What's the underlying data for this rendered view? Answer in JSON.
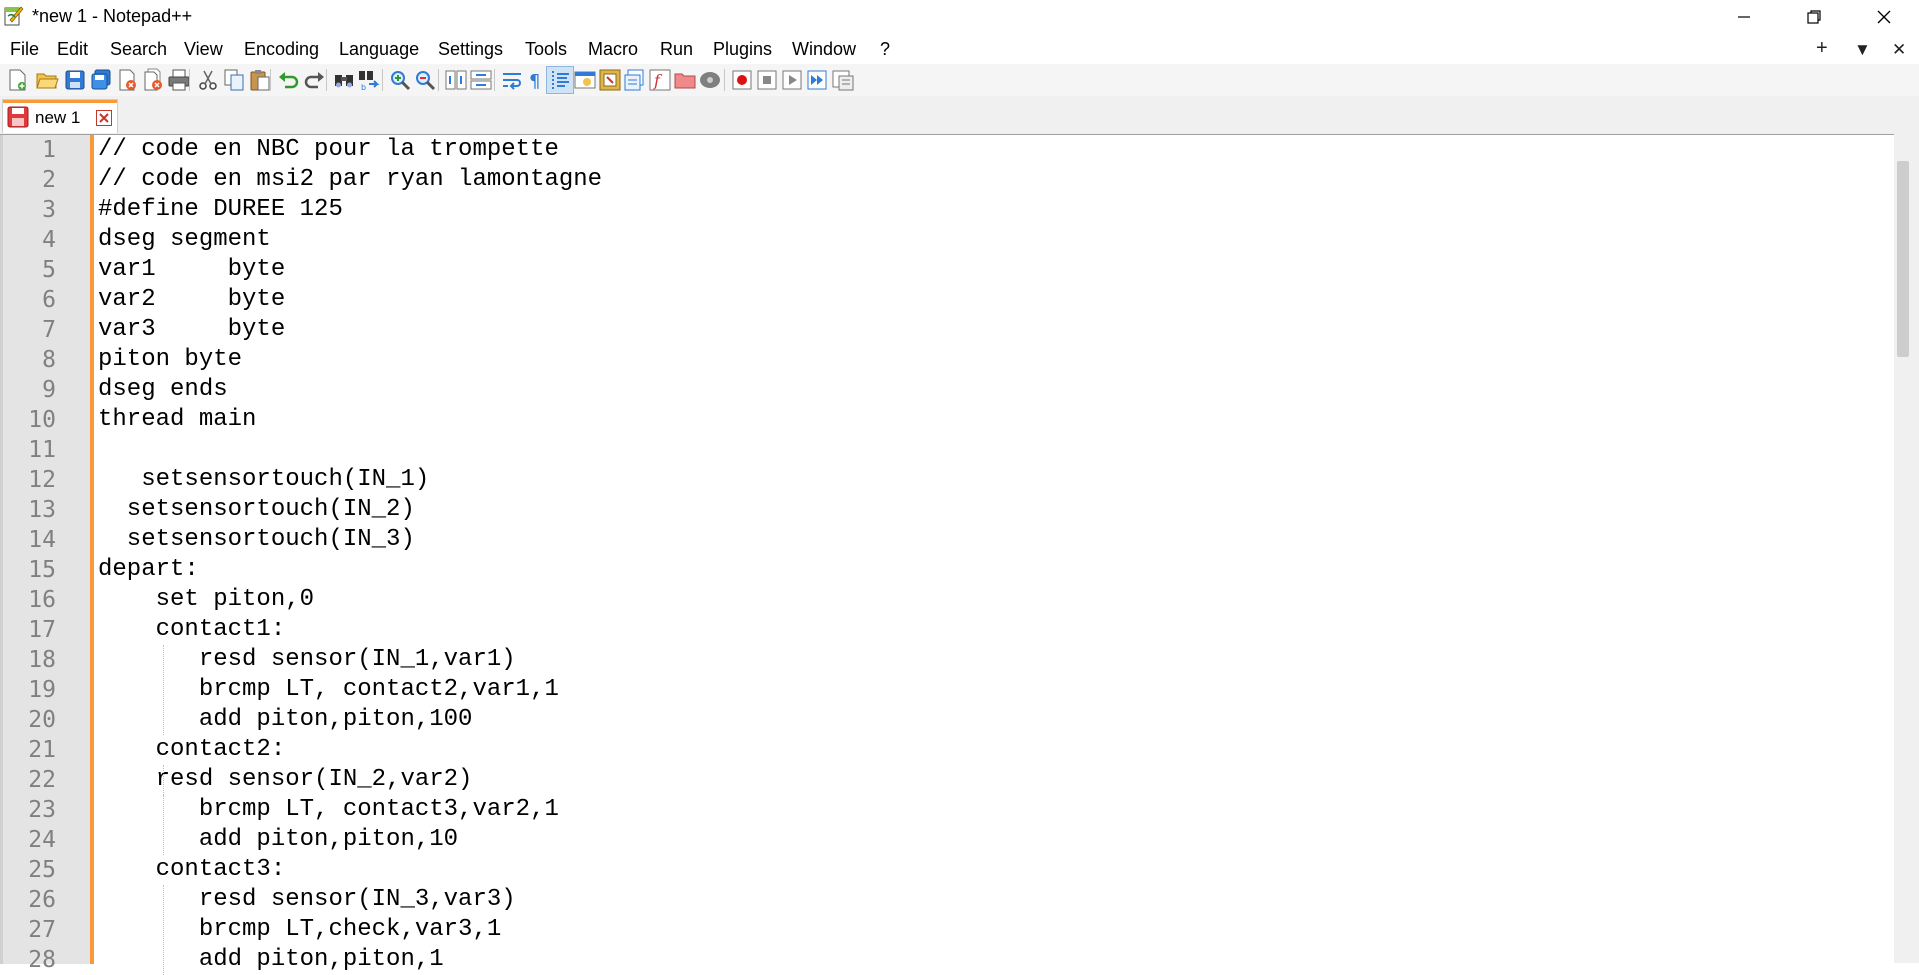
{
  "window": {
    "title": "*new 1 - Notepad++",
    "minimize_label": "—",
    "restore_label": "❐",
    "close_label": "✕"
  },
  "menu": {
    "items": [
      "File",
      "Edit",
      "Search",
      "View",
      "Encoding",
      "Language",
      "Settings",
      "Tools",
      "Macro",
      "Run",
      "Plugins",
      "Window",
      "?"
    ],
    "right_new": "+",
    "right_list": "▼",
    "right_close": "✕"
  },
  "tabs": [
    {
      "label": "new 1",
      "modified": true
    }
  ],
  "editor": {
    "line_numbers": [
      "1",
      "2",
      "3",
      "4",
      "5",
      "6",
      "7",
      "8",
      "9",
      "10",
      "11",
      "12",
      "13",
      "14",
      "15",
      "16",
      "17",
      "18",
      "19",
      "20",
      "21",
      "22",
      "23",
      "24",
      "25",
      "26",
      "27",
      "28"
    ],
    "lines": [
      "// code en NBC pour la trompette",
      "// code en msi2 par ryan lamontagne",
      "#define DUREE 125",
      "dseg segment",
      "var1     byte",
      "var2     byte",
      "var3     byte",
      "piton byte",
      "dseg ends",
      "thread main",
      "",
      "   setsensortouch(IN_1)",
      "  setsensortouch(IN_2)",
      "  setsensortouch(IN_3)",
      "depart:",
      "    set piton,0",
      "    contact1:",
      "       resd sensor(IN_1,var1)",
      "       brcmp LT, contact2,var1,1",
      "       add piton,piton,100",
      "    contact2:",
      "    resd sensor(IN_2,var2)",
      "       brcmp LT, contact3,var2,1",
      "       add piton,piton,10",
      "    contact3:",
      "       resd sensor(IN_3,var3)",
      "       brcmp LT,check,var3,1",
      "       add piton,piton,1"
    ]
  },
  "colors": {
    "accent_orange": "#f99a3a",
    "gutter_bg": "#e4e4e4",
    "line_number": "#808080",
    "toolbar_bg": "#f5f5f5"
  },
  "toolbar_icons": [
    "new-file-icon",
    "open-file-icon",
    "save-icon",
    "save-all-icon",
    "close-icon",
    "close-all-icon",
    "print-icon",
    "cut-icon",
    "copy-icon",
    "paste-icon",
    "undo-icon",
    "redo-icon",
    "find-icon",
    "replace-icon",
    "zoom-in-icon",
    "zoom-out-icon",
    "sync-vertical-icon",
    "sync-horizontal-icon",
    "word-wrap-icon",
    "show-all-chars-icon",
    "indent-guide-icon",
    "udl-icon",
    "doc-map-icon",
    "doc-list-icon",
    "function-list-icon",
    "folder-workspace-icon",
    "monitoring-icon",
    "record-macro-icon",
    "stop-record-icon",
    "play-macro-icon",
    "run-macro-multiple-icon",
    "save-macro-icon"
  ]
}
